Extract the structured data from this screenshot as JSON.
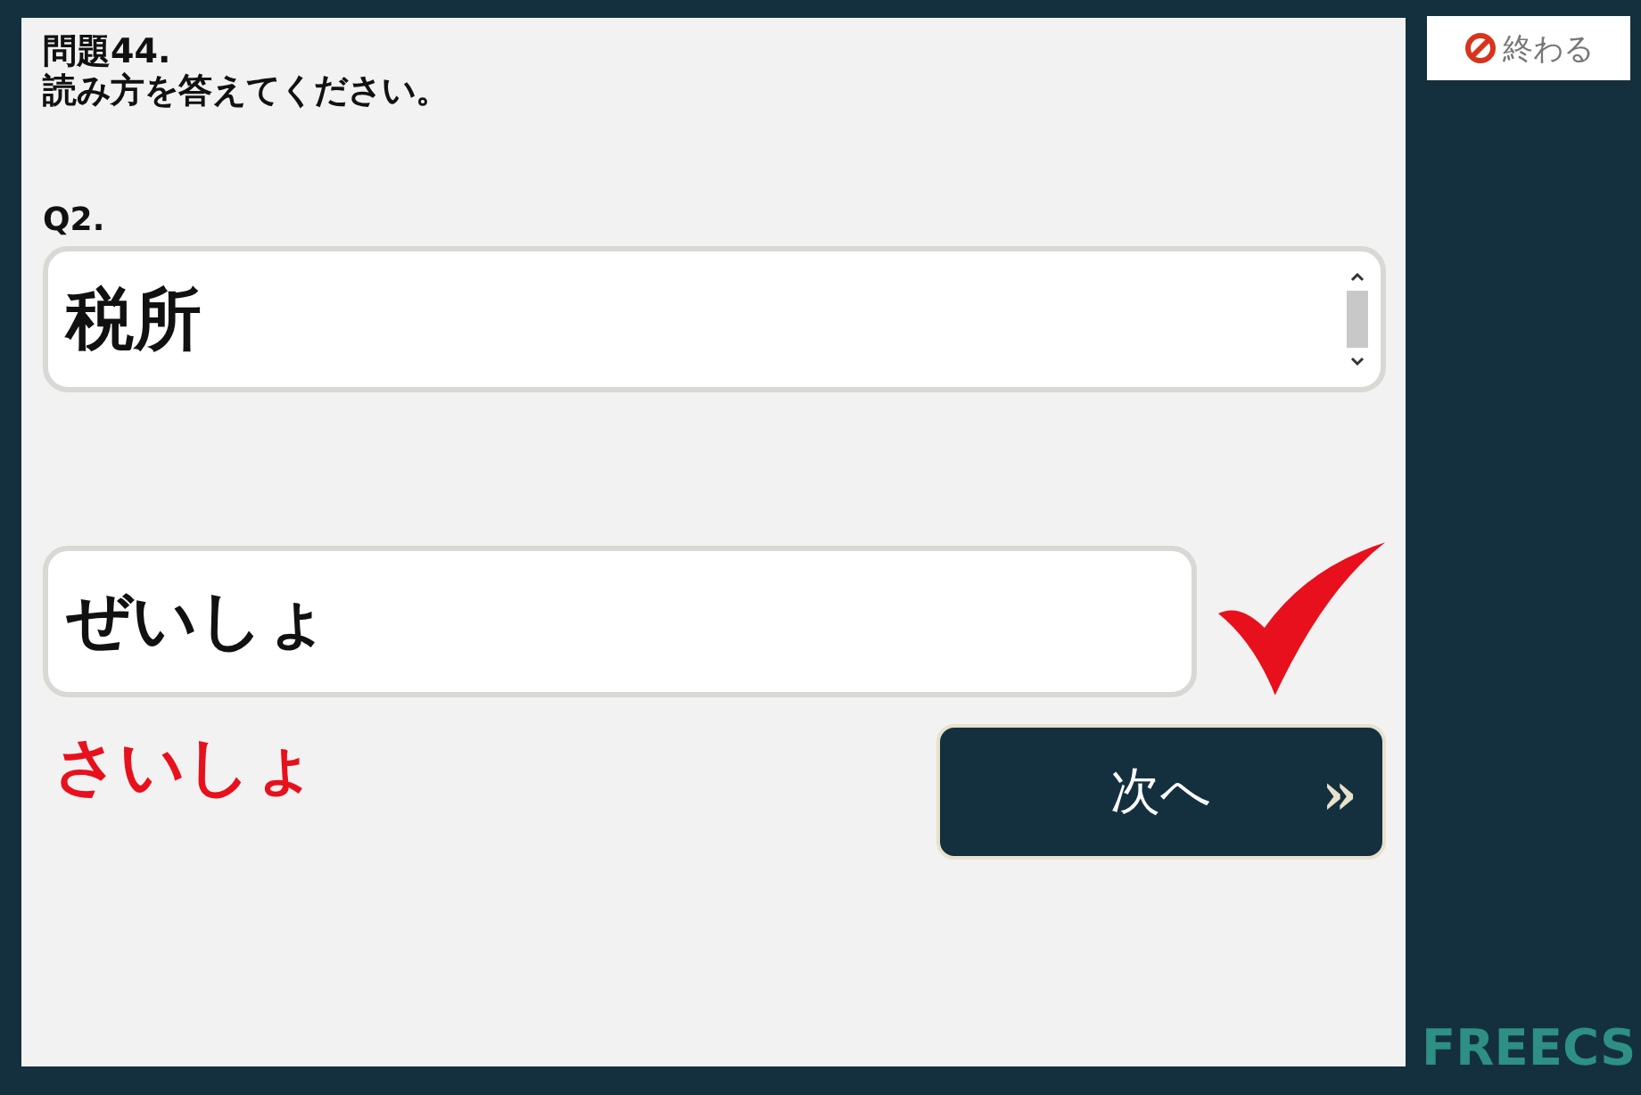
{
  "header": {
    "title": "問題44.",
    "instruction": "読み方を答えてください。"
  },
  "end_button": {
    "label": "終わる"
  },
  "question": {
    "label": "Q2.",
    "text": "税所"
  },
  "answer": {
    "value": "ぜいしょ",
    "correct": true,
    "reading": "さいしょ"
  },
  "next_button": {
    "label": "次へ",
    "arrow": "»"
  },
  "logo": "FREECS"
}
